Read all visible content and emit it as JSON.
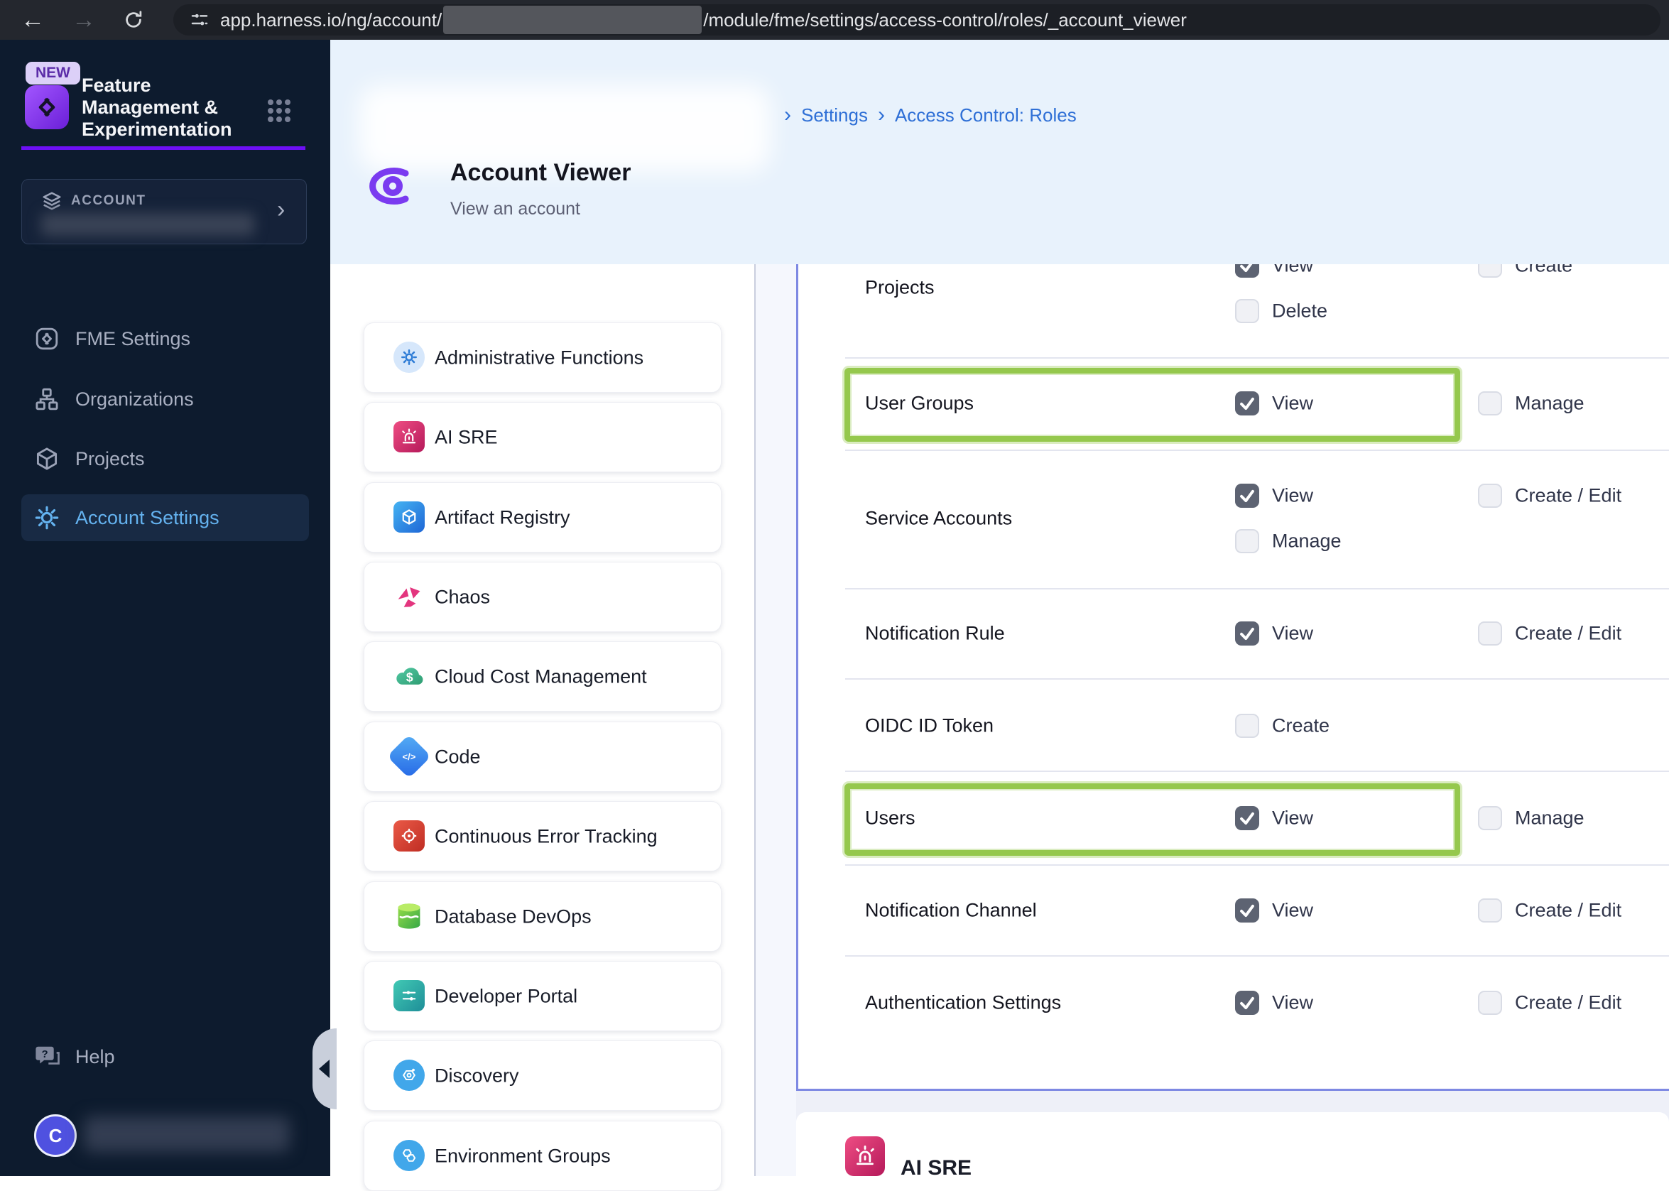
{
  "browser": {
    "url_prefix": "app.harness.io/ng/account/",
    "url_suffix": "/module/fme/settings/access-control/roles/_account_viewer",
    "back_label": "←",
    "forward_label": "→"
  },
  "sidebar": {
    "new_badge": "NEW",
    "app_title_lines": [
      "Feature",
      "Management &",
      "Experimentation"
    ],
    "account_label": "ACCOUNT",
    "account_chevron": "›",
    "items": [
      {
        "label": "FME Settings",
        "icon": "fme-logo-icon",
        "active": false
      },
      {
        "label": "Organizations",
        "icon": "org-chart-icon",
        "active": false
      },
      {
        "label": "Projects",
        "icon": "cube-icon",
        "active": false
      },
      {
        "label": "Account Settings",
        "icon": "gear-icon",
        "active": true
      }
    ],
    "help_label": "Help",
    "avatar_initial": "C"
  },
  "header": {
    "breadcrumb_separator": "›",
    "breadcrumb_links": [
      "Settings",
      "Access Control: Roles"
    ],
    "title": "Account Viewer",
    "subtitle": "View an account"
  },
  "modules": [
    {
      "label": "Administrative Functions",
      "icon": "gear-circle-icon",
      "shape": "circle",
      "bg1": "#d6e7fb",
      "bg2": "#d6e7fb"
    },
    {
      "label": "AI SRE",
      "icon": "siren-icon",
      "shape": "square",
      "bg1": "#ee4d83",
      "bg2": "#b5195a"
    },
    {
      "label": "Artifact Registry",
      "icon": "cube-white-icon",
      "shape": "square",
      "bg1": "#45b3f2",
      "bg2": "#1e66d6"
    },
    {
      "label": "Chaos",
      "icon": "chaos-icon",
      "shape": "none",
      "bg1": "",
      "bg2": ""
    },
    {
      "label": "Cloud Cost Management",
      "icon": "cloud-dollar-icon",
      "shape": "none",
      "bg1": "",
      "bg2": ""
    },
    {
      "label": "Code",
      "icon": "code-icon",
      "shape": "diamond",
      "bg1": "#55aef5",
      "bg2": "#2668e6"
    },
    {
      "label": "Continuous Error Tracking",
      "icon": "target-icon",
      "shape": "square",
      "bg1": "#ea5a47",
      "bg2": "#bf2d23"
    },
    {
      "label": "Database DevOps",
      "icon": "database-icon",
      "shape": "none",
      "bg1": "",
      "bg2": ""
    },
    {
      "label": "Developer Portal",
      "icon": "sliders-icon",
      "shape": "square",
      "bg1": "#41c9b4",
      "bg2": "#1e8e98"
    },
    {
      "label": "Discovery",
      "icon": "hex-gear-icon",
      "shape": "circle",
      "bg1": "#41a7ea",
      "bg2": "#41a7ea"
    },
    {
      "label": "Environment Groups",
      "icon": "hexagons-icon",
      "shape": "circle",
      "bg1": "#41a7ea",
      "bg2": "#41a7ea"
    }
  ],
  "permissions": {
    "rows": [
      {
        "resource": "Projects",
        "highlighted": false,
        "cells": [
          {
            "label": "View",
            "checked": true,
            "col": 0,
            "line": 0
          },
          {
            "label": "Create",
            "checked": false,
            "col": 1,
            "line": 0
          },
          {
            "label": "Delete",
            "checked": false,
            "col": 0,
            "line": 1
          }
        ]
      },
      {
        "resource": "User Groups",
        "highlighted": true,
        "cells": [
          {
            "label": "View",
            "checked": true,
            "col": 0,
            "line": 0
          },
          {
            "label": "Manage",
            "checked": false,
            "col": 1,
            "line": 0
          }
        ]
      },
      {
        "resource": "Service Accounts",
        "highlighted": false,
        "cells": [
          {
            "label": "View",
            "checked": true,
            "col": 0,
            "line": 0
          },
          {
            "label": "Create / Edit",
            "checked": false,
            "col": 1,
            "line": 0
          },
          {
            "label": "Manage",
            "checked": false,
            "col": 0,
            "line": 1
          }
        ]
      },
      {
        "resource": "Notification Rule",
        "highlighted": false,
        "cells": [
          {
            "label": "View",
            "checked": true,
            "col": 0,
            "line": 0
          },
          {
            "label": "Create / Edit",
            "checked": false,
            "col": 1,
            "line": 0
          }
        ]
      },
      {
        "resource": "OIDC ID Token",
        "highlighted": false,
        "cells": [
          {
            "label": "Create",
            "checked": false,
            "col": 0,
            "line": 0
          }
        ]
      },
      {
        "resource": "Users",
        "highlighted": true,
        "cells": [
          {
            "label": "View",
            "checked": true,
            "col": 0,
            "line": 0
          },
          {
            "label": "Manage",
            "checked": false,
            "col": 1,
            "line": 0
          }
        ]
      },
      {
        "resource": "Notification Channel",
        "highlighted": false,
        "cells": [
          {
            "label": "View",
            "checked": true,
            "col": 0,
            "line": 0
          },
          {
            "label": "Create / Edit",
            "checked": false,
            "col": 1,
            "line": 0
          }
        ]
      },
      {
        "resource": "Authentication Settings",
        "highlighted": false,
        "cells": [
          {
            "label": "View",
            "checked": true,
            "col": 0,
            "line": 0
          },
          {
            "label": "Create / Edit",
            "checked": false,
            "col": 1,
            "line": 0
          }
        ]
      }
    ]
  },
  "bottom_section": {
    "label": "AI SRE",
    "icon": "siren-icon"
  },
  "colors": {
    "accent_purple": "#6d10f5",
    "active_link_blue": "#64b2ef",
    "breadcrumb_blue": "#2e6fd6",
    "panel_border": "#7e89e3",
    "highlight_green": "#95c84d",
    "checked_checkbox": "#5d6372",
    "sidebar_bg": "#0d1b2e",
    "header_bg": "#e8f2fc"
  }
}
